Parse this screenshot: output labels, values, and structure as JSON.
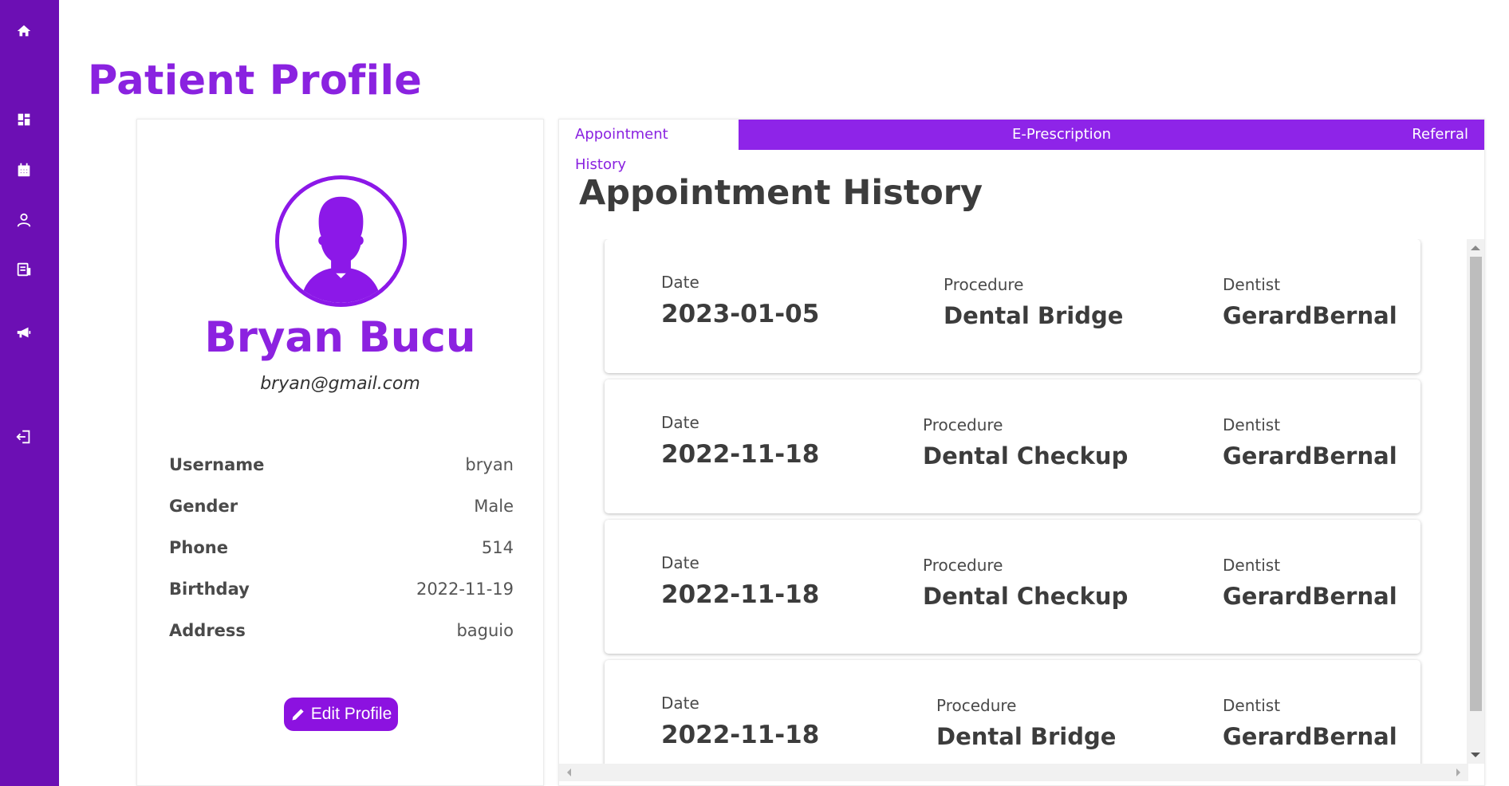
{
  "sidebar": {
    "items": [
      {
        "icon": "home-icon"
      },
      {
        "icon": "dashboard-icon"
      },
      {
        "icon": "calendar-icon"
      },
      {
        "icon": "user-icon"
      },
      {
        "icon": "records-icon"
      },
      {
        "icon": "megaphone-icon"
      },
      {
        "icon": "logout-icon"
      }
    ]
  },
  "page": {
    "title": "Patient Profile"
  },
  "profile": {
    "name": "Bryan Bucu",
    "email": "bryan@gmail.com",
    "fields": [
      {
        "label": "Username",
        "value": "bryan"
      },
      {
        "label": "Gender",
        "value": "Male"
      },
      {
        "label": "Phone",
        "value": "514"
      },
      {
        "label": "Birthday",
        "value": "2022-11-19"
      },
      {
        "label": "Address",
        "value": "baguio"
      }
    ],
    "edit_label": "Edit Profile"
  },
  "tabs": [
    {
      "label": "Appointment History",
      "active": true
    },
    {
      "label": "E-Prescription",
      "active": false
    },
    {
      "label": "Referral",
      "active": false
    }
  ],
  "history": {
    "title": "Appointment History",
    "date_label": "Date",
    "procedure_label": "Procedure",
    "dentist_label": "Dentist",
    "appointments": [
      {
        "date": "2023-01-05",
        "procedure": "Dental Bridge",
        "dentist": "GerardBernal"
      },
      {
        "date": "2022-11-18",
        "procedure": "Dental Checkup",
        "dentist": "GerardBernal"
      },
      {
        "date": "2022-11-18",
        "procedure": "Dental Checkup",
        "dentist": "GerardBernal"
      },
      {
        "date": "2022-11-18",
        "procedure": "Dental Bridge",
        "dentist": "GerardBernal"
      }
    ]
  },
  "colors": {
    "sidebar": "#6c0fb4",
    "accent": "#8a22e0",
    "tabbar": "#8e24e8"
  }
}
